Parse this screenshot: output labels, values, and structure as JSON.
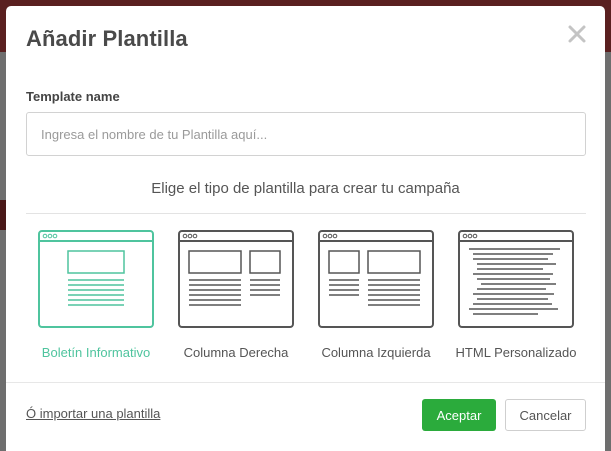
{
  "dialog": {
    "title": "Añadir Plantilla",
    "close_icon": "close-icon"
  },
  "form": {
    "name_label": "Template name",
    "name_placeholder": "Ingresa el nombre de tu Plantilla aquí...",
    "name_value": ""
  },
  "templates": {
    "heading": "Elige el tipo de plantilla para crear tu campaña",
    "items": [
      {
        "label": "Boletín Informativo",
        "icon": "newsletter-layout-icon",
        "selected": true
      },
      {
        "label": "Columna Derecha",
        "icon": "right-column-layout-icon",
        "selected": false
      },
      {
        "label": "Columna Izquierda",
        "icon": "left-column-layout-icon",
        "selected": false
      },
      {
        "label": "HTML Personalizado",
        "icon": "custom-html-layout-icon",
        "selected": false
      }
    ]
  },
  "footer": {
    "import_link": "Ó importar una plantilla",
    "accept_label": "Aceptar",
    "cancel_label": "Cancelar"
  },
  "colors": {
    "accent_selected": "#4fc49e",
    "accept_button": "#2bab3c",
    "thumb_outline": "#555555"
  }
}
